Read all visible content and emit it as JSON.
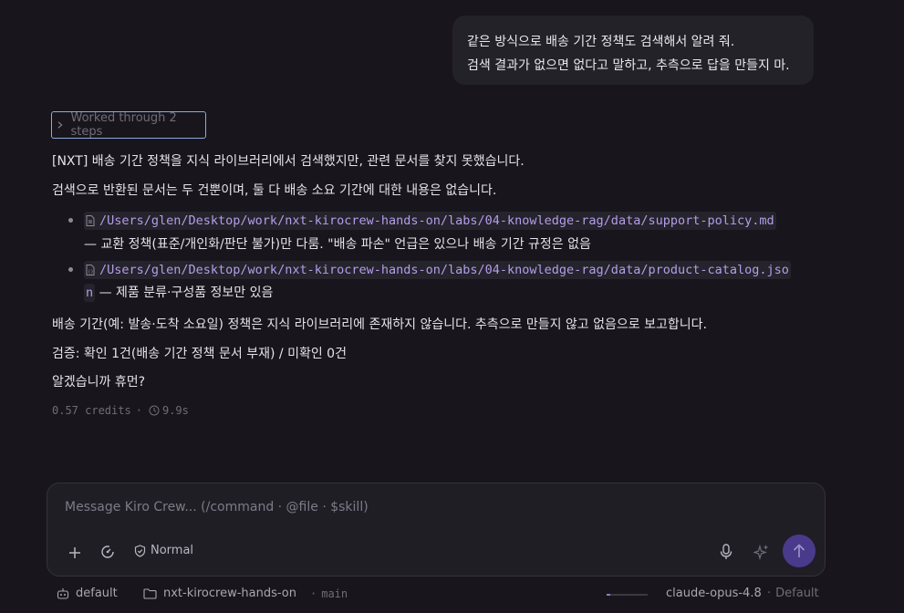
{
  "user_message": {
    "lines": [
      "같은 방식으로 배송 기간 정책도 검색해서 알려 줘.",
      "검색 결과가 없으면 없다고 말하고, 추측으로 답을 만들지 마."
    ]
  },
  "steps_label": "Worked through 2 steps",
  "response": {
    "p1": "[NXT] 배송 기간 정책을 지식 라이브러리에서 검색했지만, 관련 문서를 찾지 못했습니다.",
    "p2": "검색으로 반환된 문서는 두 건뿐이며, 둘 다 배송 소요 기간에 대한 내용은 없습니다.",
    "items": [
      {
        "path": "/Users/glen/Desktop/work/nxt-kirocrew-hands-on/labs/04-knowledge-rag/data/support-policy.md",
        "desc": "— 교환 정책(표준/개인화/판단 불가)만 다룸. \"배송 파손\" 언급은 있으나 배송 기간 규정은 없음",
        "icon": "file-icon"
      },
      {
        "path_part1": "/Users/glen/Desktop/work/nxt-kirocrew-hands-on/labs/04-knowledge-rag/data/product-catalog.jso",
        "path_part2": "n",
        "desc": " — 제품 분류·구성품 정보만 있음",
        "icon": "json-file-icon"
      }
    ],
    "p3": "배송 기간(예: 발송·도착 소요일) 정책은 지식 라이브러리에 존재하지 않습니다. 추측으로 만들지 않고 없음으로 보고합니다.",
    "p4": "검증: 확인 1건(배송 기간 정책 문서 부재) / 미확인 0건",
    "p5": "알겠습니까 휴먼?"
  },
  "meta": {
    "credits": "0.57 credits",
    "separator": "·",
    "duration": "9.9s"
  },
  "composer": {
    "placeholder": "Message Kiro Crew... (/command · @file · $skill)",
    "mode_label": "Normal"
  },
  "status_bar": {
    "agent": "default",
    "folder": "nxt-kirocrew-hands-on",
    "branch": "main",
    "model": "claude-opus-4.8",
    "model_mode": "Default",
    "context_progress": 0.08
  },
  "colors": {
    "accent": "#b49dea",
    "send_button": "#4a3a8c",
    "focus_border": "#8fa8dc"
  }
}
